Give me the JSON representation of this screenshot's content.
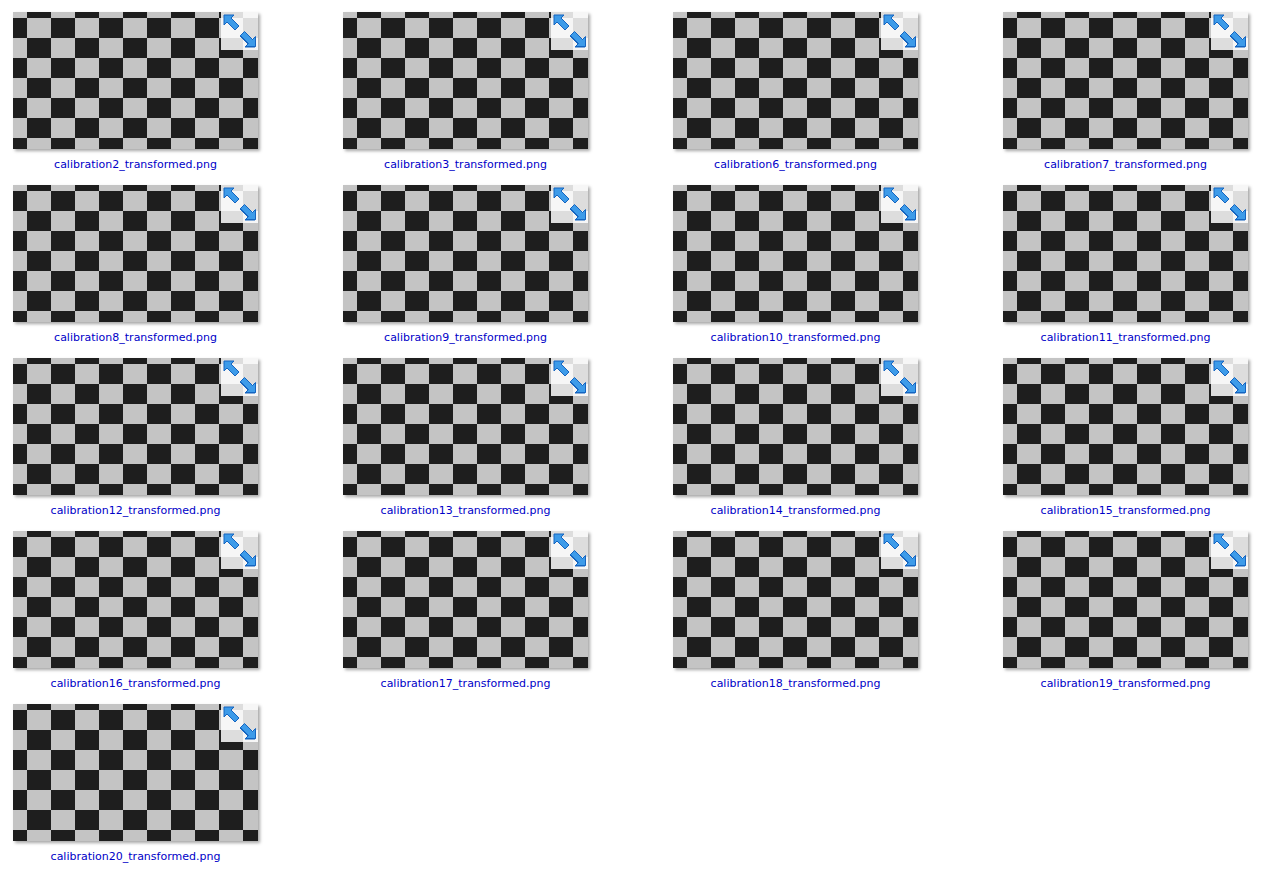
{
  "items": [
    {
      "name": "calibration2_transformed.png",
      "compressed": true
    },
    {
      "name": "calibration3_transformed.png",
      "compressed": true
    },
    {
      "name": "calibration6_transformed.png",
      "compressed": true
    },
    {
      "name": "calibration7_transformed.png",
      "compressed": true
    },
    {
      "name": "calibration8_transformed.png",
      "compressed": true
    },
    {
      "name": "calibration9_transformed.png",
      "compressed": true
    },
    {
      "name": "calibration10_transformed.png",
      "compressed": true
    },
    {
      "name": "calibration11_transformed.png",
      "compressed": true
    },
    {
      "name": "calibration12_transformed.png",
      "compressed": true
    },
    {
      "name": "calibration13_transformed.png",
      "compressed": true
    },
    {
      "name": "calibration14_transformed.png",
      "compressed": true
    },
    {
      "name": "calibration15_transformed.png",
      "compressed": true
    },
    {
      "name": "calibration16_transformed.png",
      "compressed": true
    },
    {
      "name": "calibration17_transformed.png",
      "compressed": true
    },
    {
      "name": "calibration18_transformed.png",
      "compressed": true
    },
    {
      "name": "calibration19_transformed.png",
      "compressed": true
    },
    {
      "name": "calibration20_transformed.png",
      "compressed": true
    }
  ]
}
